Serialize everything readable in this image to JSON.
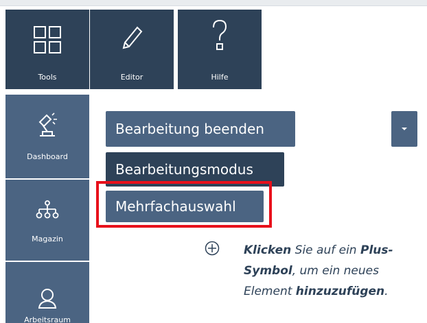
{
  "sidebar": {
    "items": [
      {
        "label": "Tools",
        "icon": "grid-icon"
      },
      {
        "label": "Dashboard",
        "icon": "lamp-icon"
      },
      {
        "label": "Magazin",
        "icon": "sitemap-icon"
      },
      {
        "label": "Arbeitsraum",
        "icon": "user-icon"
      }
    ]
  },
  "toolbar": {
    "editor_label": "Editor",
    "help_label": "Hilfe"
  },
  "actions": {
    "end_edit_label": "Bearbeitung beenden",
    "edit_mode_label": "Bearbeitungsmodus",
    "multi_select_label": "Mehrfachauswahl"
  },
  "hint": {
    "part1": "Klicken",
    "part2": " Sie auf ein ",
    "part3": "Plus-Symbol",
    "part4": ", um ein neues Element ",
    "part5": "hinzuzufügen",
    "part6": "."
  },
  "colors": {
    "primary": "#4b6482",
    "primary_dark": "#2e4258",
    "highlight": "#e8101b"
  }
}
